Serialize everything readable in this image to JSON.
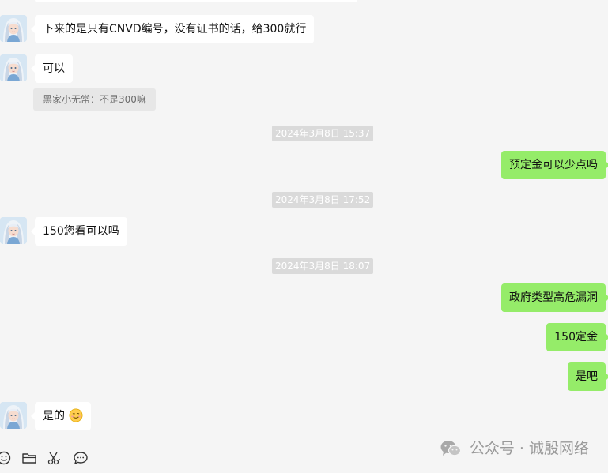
{
  "messages": [
    {
      "direction": "in",
      "text": "下来的是只有CNVD编号，没有证书的话，给300就行"
    },
    {
      "direction": "in",
      "text": "可以",
      "quote": "黑家小无常：不是300嘛"
    },
    {
      "type": "time",
      "text": "2024年3月8日 15:37"
    },
    {
      "direction": "out",
      "text": "预定金可以少点吗"
    },
    {
      "type": "time",
      "text": "2024年3月8日 17:52"
    },
    {
      "direction": "in",
      "text": "150您看可以吗"
    },
    {
      "type": "time",
      "text": "2024年3月8日 18:07"
    },
    {
      "direction": "out",
      "text": "政府类型高危漏洞"
    },
    {
      "direction": "out",
      "text": "150定金"
    },
    {
      "direction": "out",
      "text": "是吧"
    },
    {
      "direction": "in",
      "text": "是的",
      "emoji": "smiling-face-emoji"
    }
  ],
  "toolbar": {
    "icons": [
      "emoji-icon",
      "folder-icon",
      "scissors-icon",
      "chat-bubble-icon"
    ]
  },
  "watermark": {
    "text": "公众号 · 诚殷网络",
    "icon": "wechat-logo-icon"
  },
  "colors": {
    "background": "#f5f5f5",
    "incoming_bubble": "#ffffff",
    "outgoing_bubble": "#95ec69",
    "timestamp_bg": "#dadada",
    "quote_bg": "#e7e7e7"
  }
}
